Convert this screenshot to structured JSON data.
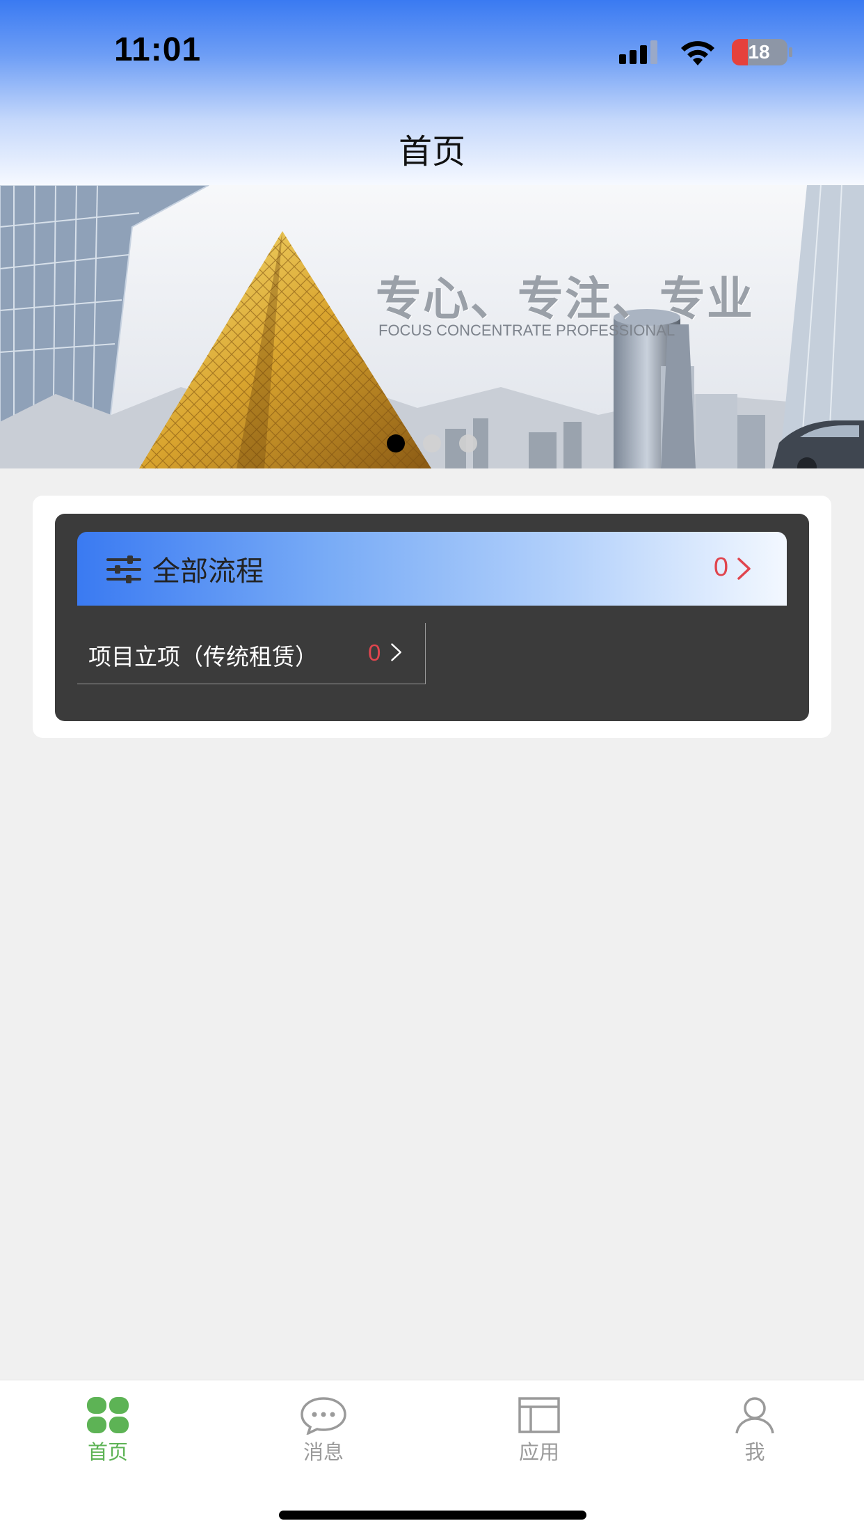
{
  "status_bar": {
    "time": "11:01",
    "battery": "18",
    "icons": [
      "signal-icon",
      "wifi-icon",
      "battery-charging-icon"
    ]
  },
  "header": {
    "title": "首页"
  },
  "banner": {
    "slogan": "专心、专注、专业",
    "subtitle": "FOCUS CONCENTRATE PROFESSIONAL",
    "dots_total": 3,
    "active_dot": 1
  },
  "process_card": {
    "all": {
      "label": "全部流程",
      "count": "0",
      "icon": "sliders-icon"
    },
    "items": [
      {
        "label": "项目立项（传统租赁）",
        "count": "0"
      }
    ]
  },
  "tabbar": {
    "active_color": "#5db355",
    "inactive_color": "#9a9a9a",
    "tabs": [
      {
        "label": "首页",
        "icon": "home-grid-icon",
        "active": true
      },
      {
        "label": "消息",
        "icon": "chat-bubble-icon",
        "active": false
      },
      {
        "label": "应用",
        "icon": "apps-layout-icon",
        "active": false
      },
      {
        "label": "我",
        "icon": "user-icon",
        "active": false
      }
    ]
  },
  "colors": {
    "header_blue": "#3a7af2",
    "count_red": "#e0454e",
    "panel_dark": "#3b3b3b"
  }
}
